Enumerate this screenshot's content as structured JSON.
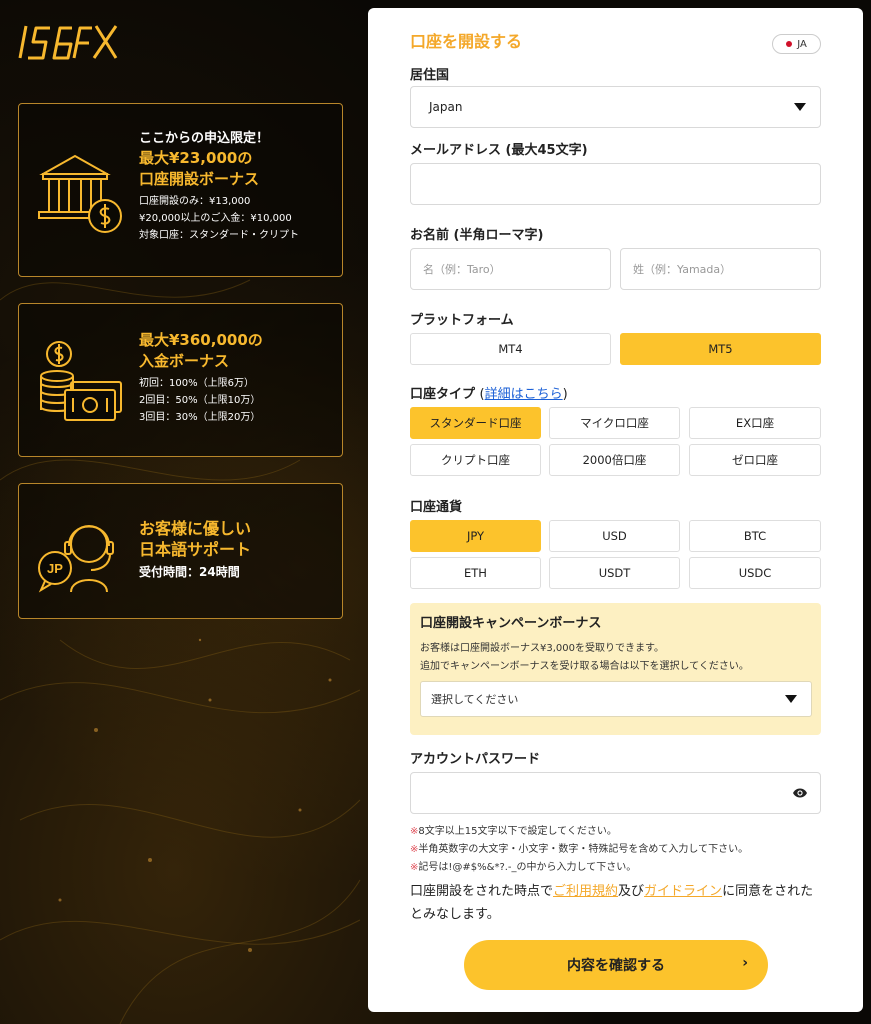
{
  "brand": {
    "logo_text": "IS6FX",
    "accent": "#f7b82e"
  },
  "promos": [
    {
      "icon": "bank-coin-icon",
      "lead": "ここからの申込限定！",
      "heading1": "最大¥23,000の",
      "heading2": "口座開設ボーナス",
      "lines": [
        "口座開設のみ：¥13,000",
        "¥20,000以上のご入金：¥10,000",
        "対象口座：スタンダード・クリプト"
      ]
    },
    {
      "icon": "coins-cash-icon",
      "heading1": "最大¥360,000の",
      "heading2": "入金ボーナス",
      "lines": [
        "初回：100%（上限6万）",
        "2回目：50%（上限10万）",
        "3回目：30%（上限20万）"
      ]
    },
    {
      "icon": "support-agent-icon",
      "icon_badge": "JP",
      "heading1": "お客様に優しい",
      "heading2": "日本語サポート",
      "lines": [
        "受付時間：24時間"
      ]
    }
  ],
  "form": {
    "title": "口座を開設する",
    "lang": "JA",
    "country_label": "居住国",
    "country_value": "Japan",
    "email_label": "メールアドレス",
    "email_sub": "(最大45文字)",
    "email_value": "",
    "name_label": "お名前",
    "name_sub": "(半角ローマ字)",
    "first_name_placeholder": "名（例：Taro）",
    "last_name_placeholder": "姓（例：Yamada）",
    "platform_label": "プラットフォーム",
    "platforms": [
      "MT4",
      "MT5"
    ],
    "platform_selected": "MT5",
    "account_type_label": "口座タイプ",
    "account_type_link_open": "(",
    "account_type_link": "詳細はこちら",
    "account_type_link_close": ")",
    "account_types": [
      "スタンダード口座",
      "マイクロ口座",
      "EX口座",
      "クリプト口座",
      "2000倍口座",
      "ゼロ口座"
    ],
    "account_type_selected": "スタンダード口座",
    "currency_label": "口座通貨",
    "currencies": [
      "JPY",
      "USD",
      "BTC",
      "ETH",
      "USDT",
      "USDC"
    ],
    "currency_selected": "JPY",
    "campaign": {
      "title": "口座開設キャンペーンボーナス",
      "line1": "お客様は口座開設ボーナス¥3,000を受取りできます。",
      "line2": "追加でキャンペーンボーナスを受け取る場合は以下を選択してください。",
      "select_value": "選択してください"
    },
    "password_label": "アカウントパスワード",
    "password_value": "",
    "password_notes": [
      "8文字以上15文字以下で設定してください。",
      "半角英数字の大文字・小文字・数字・特殊記号を含めて入力して下さい。",
      "記号は!@#$%&*?.-_の中から入力して下さい。"
    ],
    "note_mark": "※",
    "agree_prefix": "口座開設をされた時点で",
    "agree_terms": "ご利用規約",
    "agree_mid": "及び",
    "agree_guideline": "ガイドライン",
    "agree_suffix": "に同意をされたとみなします。",
    "submit_label": "内容を確認する",
    "submit_arrow": "›"
  }
}
